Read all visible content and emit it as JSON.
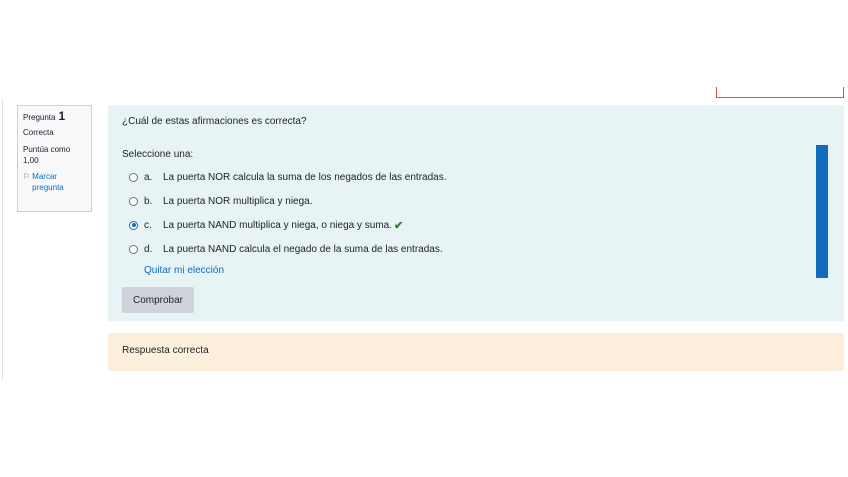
{
  "info": {
    "question_label": "Pregunta",
    "question_number": "1",
    "state": "Correcta",
    "grade": "Puntúa como 1,00",
    "flag_label": "Marcar pregunta"
  },
  "question": {
    "text": "¿Cuál de estas afirmaciones es correcta?",
    "prompt": "Seleccione una:",
    "answers": [
      {
        "letter": "a.",
        "text": "La puerta NOR calcula la suma de los negados de las entradas."
      },
      {
        "letter": "b.",
        "text": "La puerta NOR multiplica y niega."
      },
      {
        "letter": "c.",
        "text": "La puerta NAND multiplica y niega, o niega y suma."
      },
      {
        "letter": "d.",
        "text": "La puerta NAND calcula el negado de la suma de las entradas."
      }
    ],
    "selected": "c.",
    "clear_label": "Quitar mi elección",
    "check_label": "Comprobar"
  },
  "feedback": {
    "text": "Respuesta correcta"
  },
  "colors": {
    "accent": "#0f6cbf",
    "correct": "#357a32",
    "formulation_bg": "#e7f3f5",
    "feedback_bg": "#fcefdc"
  }
}
